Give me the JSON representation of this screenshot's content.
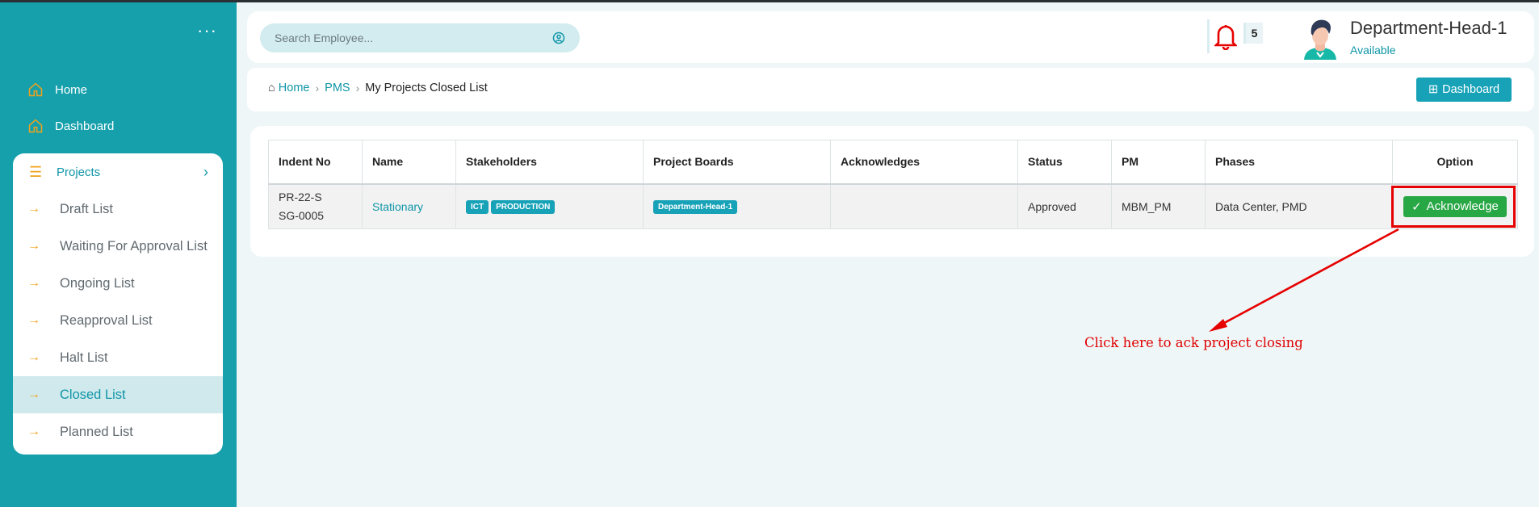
{
  "sidebar": {
    "menu_icon": "ellipsis-icon",
    "top_items": [
      {
        "label": "Home",
        "icon": "home-icon"
      },
      {
        "label": "Dashboard",
        "icon": "home-icon"
      }
    ],
    "section": {
      "label": "Projects",
      "icon": "list-icon",
      "expand_icon": "chevron-right-icon"
    },
    "sub_items": [
      {
        "label": "Draft List"
      },
      {
        "label": "Waiting For Approval List"
      },
      {
        "label": "Ongoing List"
      },
      {
        "label": "Reapproval List"
      },
      {
        "label": "Halt List"
      },
      {
        "label": "Closed List"
      },
      {
        "label": "Planned List"
      }
    ],
    "active_item": "Closed List"
  },
  "header": {
    "search_placeholder": "Search Employee...",
    "notification_count": "5",
    "user_name": "Department-Head-1",
    "user_status": "Available"
  },
  "breadcrumb": {
    "home": "Home",
    "pms": "PMS",
    "current": "My Projects Closed List",
    "dashboard_button": "Dashboard"
  },
  "table": {
    "columns": [
      "Indent No",
      "Name",
      "Stakeholders",
      "Project Boards",
      "Acknowledges",
      "Status",
      "PM",
      "Phases",
      "Option"
    ],
    "rows": [
      {
        "indent_no": "PR-22-SSG-0005",
        "name": "Stationary",
        "stakeholders": [
          "ICT",
          "PRODUCTION"
        ],
        "project_board": "Department-Head-1",
        "acknowledges": "",
        "status": "Approved",
        "pm": "MBM_PM",
        "phases": "Data Center, PMD",
        "option_label": "Acknowledge"
      }
    ]
  },
  "annotation": {
    "text": "Click here to ack project closing",
    "color": "#e00000"
  },
  "colors": {
    "sidebar": "#16a0ac",
    "accent": "#17a2b8",
    "acknowledge": "#28a745",
    "bell": "#e60000"
  }
}
